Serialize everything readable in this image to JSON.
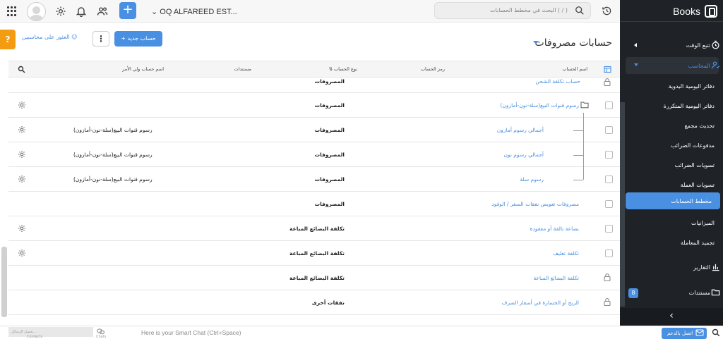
{
  "topbar": {
    "org_name": "OQ ALFAREED EST...",
    "search_placeholder": "البحث في مخطط الحسابات ( / )",
    "plus_label": "+"
  },
  "sidebar": {
    "brand": "Books",
    "time_tracking": "تتبع الوقت",
    "accountant": "المحاسب",
    "sub_items": [
      "دفاتر اليومية اليدوية",
      "دفاتر اليومية المتكررة",
      "تحديث مجمع",
      "مدفوعات الضرائب",
      "تسويات الضرائب",
      "تسويات العملة",
      "مخطط الحسابات",
      "الميزانيات",
      "تجميد المعاملة"
    ],
    "reports": "التقارير",
    "documents": "مستندات",
    "documents_badge": "8",
    "collapse": "‹"
  },
  "header": {
    "title": "حسابات مصروفات",
    "find_accountants": "العثور على محاسبين",
    "new_account": "+ حساب جديد",
    "more": "⋮",
    "help": "?"
  },
  "table": {
    "columns": {
      "name": "اسم الحساب",
      "code": "رمز الحساب",
      "type": "نوع الحساب",
      "documents": "مستندات",
      "parent": "اسم حساب ولي الأمر"
    },
    "rows": [
      {
        "name": "حساب تكلفة الشحن",
        "type": "المصروفات",
        "parent": ""
      },
      {
        "name": "رسوم قنوات البيع(سلة-نون-أمازون)",
        "type": "المصروفات",
        "parent": ""
      },
      {
        "name": "أجمالي رسوم أمازون",
        "type": "المصروفات",
        "parent": "رسوم قنوات البيع(سلة-نون-أمازون)"
      },
      {
        "name": "أجمالي رسوم نون",
        "type": "المصروفات",
        "parent": "رسوم قنوات البيع(سلة-نون-أمازون)"
      },
      {
        "name": "رسوم سلة",
        "type": "المصروفات",
        "parent": "رسوم قنوات البيع(سلة-نون-أمازون)"
      },
      {
        "name": "مصروفات تعويض نفقات السفر / الوفود",
        "type": "المصروفات",
        "parent": ""
      },
      {
        "name": "بضاعة تالفة أو مفقودة",
        "type": "تكلفة البضائع المباعة",
        "parent": ""
      },
      {
        "name": "تكلفة تغليف",
        "type": "تكلفة البضائع المباعة",
        "parent": ""
      },
      {
        "name": "تكلفة البضائع المباعة",
        "type": "تكلفة البضائع المباعة",
        "parent": ""
      },
      {
        "name": "الربح أو الخسارة في أسعار الصرف",
        "type": "نفقات أخرى",
        "parent": ""
      }
    ]
  },
  "bottombar": {
    "chat_tile": "تحميل الرسائل...",
    "contacts": "Contacts",
    "chats": "Chats",
    "smart_chat": "Here is your Smart Chat (Ctrl+Space)",
    "support": "اتصل بالدعم"
  }
}
